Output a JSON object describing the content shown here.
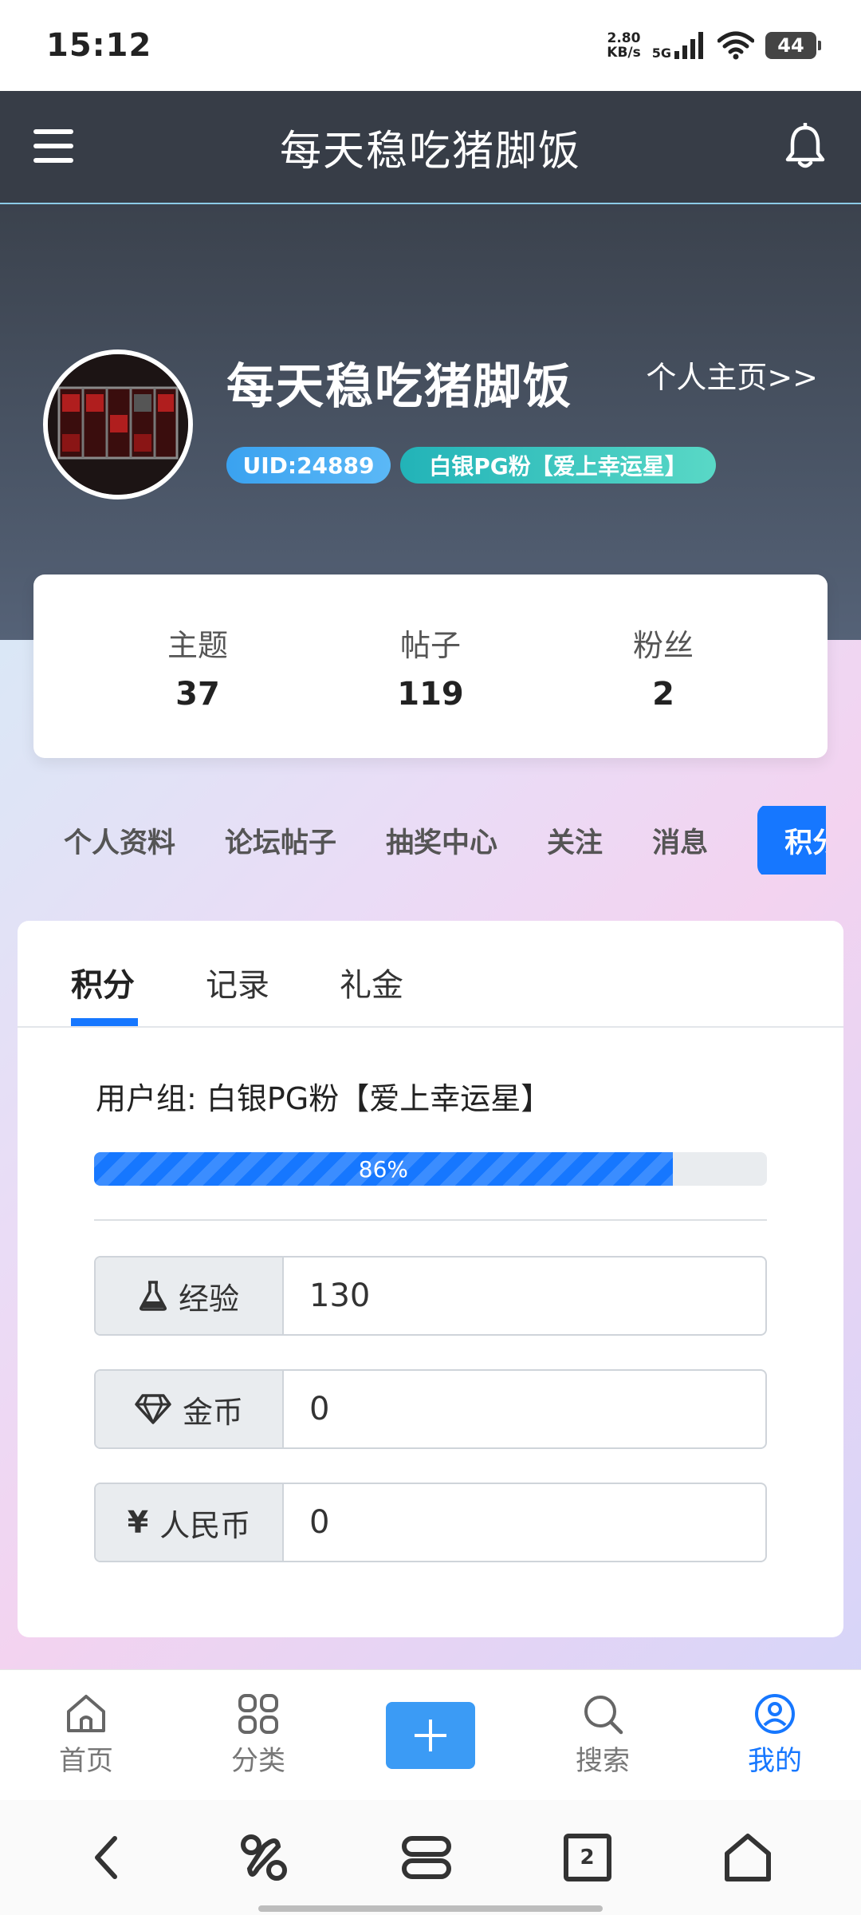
{
  "status_bar": {
    "time": "15:12",
    "net_speed_value": "2.80",
    "net_speed_unit": "KB/s",
    "signal_label": "5G",
    "battery": "44"
  },
  "header": {
    "title": "每天稳吃猪脚饭"
  },
  "profile": {
    "name": "每天稳吃猪脚饭",
    "home_link": "个人主页>>",
    "uid_badge": "UID:24889",
    "group_badge": "白银PG粉【爱上幸运星】"
  },
  "stats": [
    {
      "label": "主题",
      "value": "37"
    },
    {
      "label": "帖子",
      "value": "119"
    },
    {
      "label": "粉丝",
      "value": "2"
    }
  ],
  "section_tabs": [
    "个人资料",
    "论坛帖子",
    "抽奖中心",
    "关注",
    "消息",
    "积分"
  ],
  "panel": {
    "tabs": [
      "积分",
      "记录",
      "礼金"
    ],
    "group_line": "用户组: 白银PG粉【爱上幸运星】",
    "progress_label": "86%",
    "progress_fraction": 0.86,
    "fields": [
      {
        "label": "经验",
        "value": "130",
        "icon": "flask-icon"
      },
      {
        "label": "金币",
        "value": "0",
        "icon": "diamond-icon"
      },
      {
        "label": "人民币",
        "value": "0",
        "icon": "yen-icon",
        "icon_char": "¥"
      }
    ]
  },
  "bottom_nav": [
    {
      "label": "首页",
      "icon": "home-icon"
    },
    {
      "label": "分类",
      "icon": "grid-icon"
    },
    {
      "label": "",
      "icon": "plus-icon"
    },
    {
      "label": "搜索",
      "icon": "search-icon"
    },
    {
      "label": "我的",
      "icon": "user-icon",
      "active": true
    }
  ],
  "system_nav": {
    "recents_count": "2"
  },
  "colors": {
    "accent": "#1677ff",
    "header_bg": "#373d47",
    "uid_badge": "#3aa2f0",
    "group_badge": "#22b3b8"
  }
}
